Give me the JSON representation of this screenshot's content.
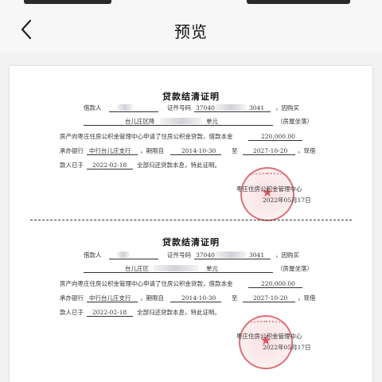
{
  "nav": {
    "title": "预览"
  },
  "certs": [
    {
      "title": "贷款结清证明",
      "borrower_label": "借款人",
      "id_label": "证件号码",
      "id_prefix": "37040",
      "id_suffix": "3041",
      "purchase": "，因购买",
      "addr_prefix": "台儿庄区降",
      "addr_unit": "单元",
      "housing_type": "（房屋坐落）",
      "line2": "房产向枣庄住房公积金管理中心申请了住房公积金贷款，借款本金",
      "loan_amount": "220,000.00",
      "bank_label": "承办银行",
      "bank_name": "中行台儿庄支行",
      "period_label": "，期限自",
      "start_date": "2014-10-30",
      "to_label": "至",
      "end_date": "2027-10-20",
      "borrow_now": "，现借",
      "prefix_line4": "款人已于",
      "payoff_date": "2022-02-18",
      "settled_text": "全部归还贷款本息，特此证明。",
      "issuer": "枣庄住房公积金管理中心",
      "issue_date": "2022年05月17日"
    },
    {
      "title": "贷款结清证明",
      "borrower_label": "借款人",
      "id_label": "证件号码",
      "id_prefix": "37040",
      "id_suffix": "3041",
      "purchase": "，因购买",
      "addr_prefix": "台儿庄区",
      "addr_unit": "单元",
      "housing_type": "（房屋坐落）",
      "line2": "房产向枣庄住房公积金管理中心申请了住房公积金贷款，借款本金",
      "loan_amount": "220,000.00",
      "bank_label": "承办银行",
      "bank_name": "中行台儿庄支行",
      "period_label": "，期限自",
      "start_date": "2014-10-30",
      "to_label": "至",
      "end_date": "2027-10-20",
      "borrow_now": "，现借",
      "prefix_line4": "款人已于",
      "payoff_date": "2022-02-18",
      "settled_text": "全部归还贷款本息，特此证明。",
      "issuer": "枣庄住房公积金管理中心",
      "issue_date": "2022年05月17日"
    }
  ],
  "colors": {
    "seal": "#d2464f",
    "background": "#f2f2f2",
    "paper": "#ffffff"
  }
}
